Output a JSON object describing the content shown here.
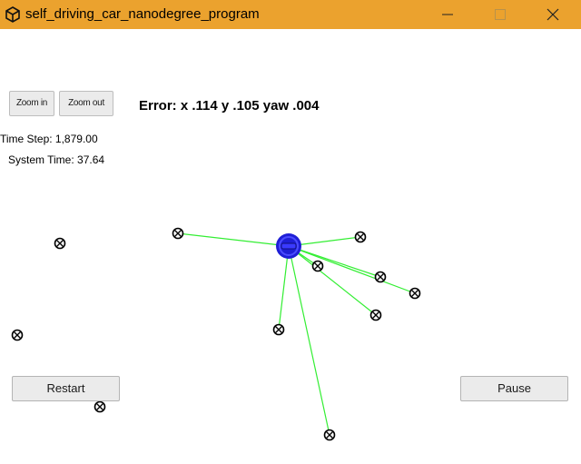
{
  "window": {
    "title": "self_driving_car_nanodegree_program",
    "title_bar_color": "#eba22e",
    "app_icon": "unity-icon"
  },
  "toolbar": {
    "zoom_in_label": "Zoom in",
    "zoom_out_label": "Zoom out"
  },
  "status": {
    "error_text": "Error: x .114 y .105 yaw .004",
    "time_step_text": "Time Step: 1,879.00",
    "system_time_text": "System Time: 37.64"
  },
  "controls": {
    "restart_label": "Restart",
    "pause_label": "Pause"
  },
  "scene": {
    "car_color": "#2222dd",
    "observation_line_color": "#33ee33",
    "landmark_icon": "landmark-x-circle-icon",
    "landmark_count": 12,
    "observation_count": 8
  }
}
